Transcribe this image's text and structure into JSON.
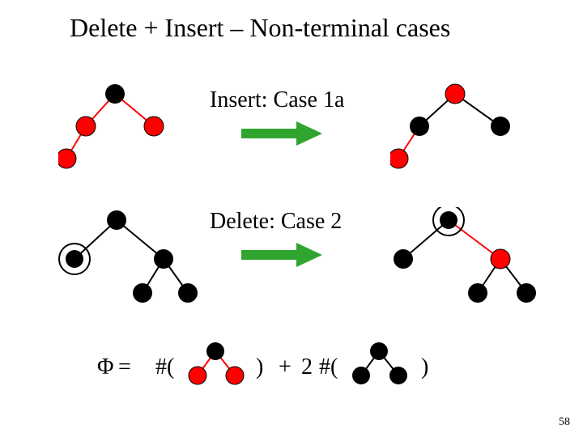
{
  "title": "Delete + Insert – Non-terminal cases",
  "labels": {
    "insert": "Insert: Case 1a",
    "delete": "Delete: Case 2"
  },
  "formula": {
    "phi": "Φ",
    "eq": "=",
    "hash1": "#(",
    "close1": ")",
    "plus": "+",
    "two": "2",
    "hash2": "#(",
    "close2": ")"
  },
  "pagenum": "58",
  "chart_data": {
    "type": "diagram",
    "title": "Delete + Insert – Non-terminal cases",
    "colors": {
      "black": "#000000",
      "red": "#ff0000",
      "arrow": "#2fa52f"
    },
    "insert_case": {
      "label": "Insert: Case 1a",
      "before": {
        "nodes": [
          {
            "id": "g1",
            "color": "black",
            "x": 0,
            "y": 0
          },
          {
            "id": "p1",
            "color": "red",
            "x": -1,
            "y": 1
          },
          {
            "id": "u1",
            "color": "red",
            "x": 1,
            "y": 1
          },
          {
            "id": "x1",
            "color": "red",
            "x": -2,
            "y": 2
          }
        ],
        "edges": [
          [
            "g1",
            "p1",
            "red"
          ],
          [
            "g1",
            "u1",
            "red"
          ],
          [
            "p1",
            "x1",
            "red"
          ]
        ]
      },
      "after": {
        "nodes": [
          {
            "id": "g2",
            "color": "red",
            "x": 0,
            "y": 0
          },
          {
            "id": "p2",
            "color": "black",
            "x": -1,
            "y": 1
          },
          {
            "id": "u2",
            "color": "black",
            "x": 1,
            "y": 1
          },
          {
            "id": "x2",
            "color": "red",
            "x": -2,
            "y": 2
          }
        ],
        "edges": [
          [
            "g2",
            "p2",
            "black"
          ],
          [
            "g2",
            "u2",
            "black"
          ],
          [
            "p2",
            "x2",
            "red"
          ]
        ]
      }
    },
    "delete_case": {
      "label": "Delete: Case 2",
      "before": {
        "nodes": [
          {
            "id": "a1",
            "color": "black",
            "x": 0,
            "y": 0
          },
          {
            "id": "b1",
            "color": "black",
            "x": -1.2,
            "y": 1,
            "double": true
          },
          {
            "id": "c1",
            "color": "black",
            "x": 1,
            "y": 1
          },
          {
            "id": "d1",
            "color": "black",
            "x": 0.4,
            "y": 2
          },
          {
            "id": "e1",
            "color": "black",
            "x": 1.6,
            "y": 2
          }
        ],
        "edges": [
          [
            "a1",
            "b1",
            "black"
          ],
          [
            "a1",
            "c1",
            "black"
          ],
          [
            "c1",
            "d1",
            "black"
          ],
          [
            "c1",
            "e1",
            "black"
          ]
        ]
      },
      "after": {
        "nodes": [
          {
            "id": "a2",
            "color": "black",
            "x": 0,
            "y": 0,
            "double": true
          },
          {
            "id": "b2",
            "color": "black",
            "x": -1.2,
            "y": 1
          },
          {
            "id": "c2",
            "color": "red",
            "x": 1,
            "y": 1
          },
          {
            "id": "d2",
            "color": "black",
            "x": 0.4,
            "y": 2
          },
          {
            "id": "e2",
            "color": "black",
            "x": 1.6,
            "y": 2
          }
        ],
        "edges": [
          [
            "a2",
            "b2",
            "black"
          ],
          [
            "a2",
            "c2",
            "red"
          ],
          [
            "c2",
            "d2",
            "black"
          ],
          [
            "c2",
            "e2",
            "black"
          ]
        ]
      }
    },
    "potential_formula": "Φ = #(black-with-two-red-children) + 2·#(black-with-two-black-children)"
  }
}
